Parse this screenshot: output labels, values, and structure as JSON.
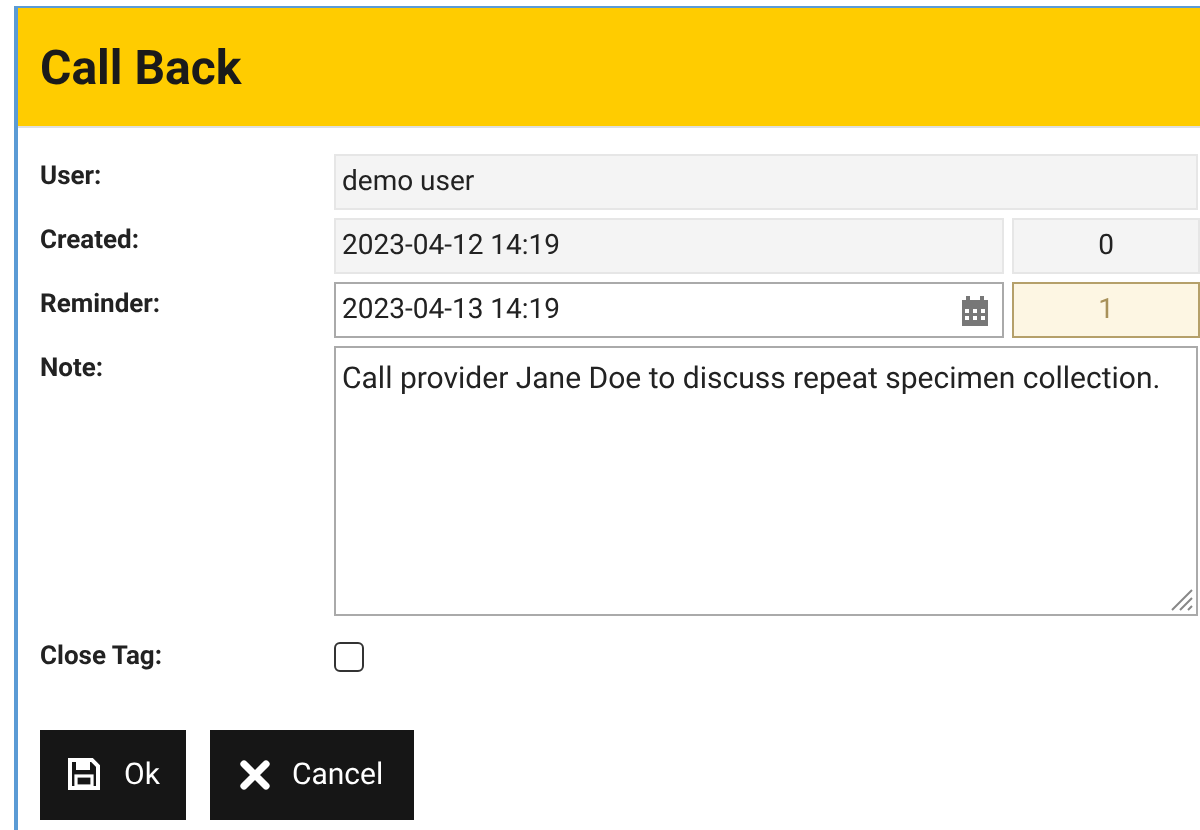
{
  "title": "Call Back",
  "fields": [
    {
      "label": "User:",
      "value": "demo user",
      "kind": "readonly"
    },
    {
      "label": "Created:",
      "value": "2023-04-12 14:19",
      "kind": "readonly",
      "count": {
        "value": "0",
        "highlighted": false
      }
    },
    {
      "label": "Reminder:",
      "value": "2023-04-13 14:19",
      "kind": "date",
      "count": {
        "value": "1",
        "highlighted": true
      }
    },
    {
      "label": "Note:",
      "value": "Call provider Jane Doe to discuss repeat specimen collection.",
      "kind": "textarea"
    },
    {
      "label": "Close Tag:",
      "kind": "checkbox",
      "checked": false
    }
  ],
  "buttons": [
    {
      "label": "Ok",
      "kind": "save"
    },
    {
      "label": "Cancel",
      "kind": "cancel"
    }
  ]
}
